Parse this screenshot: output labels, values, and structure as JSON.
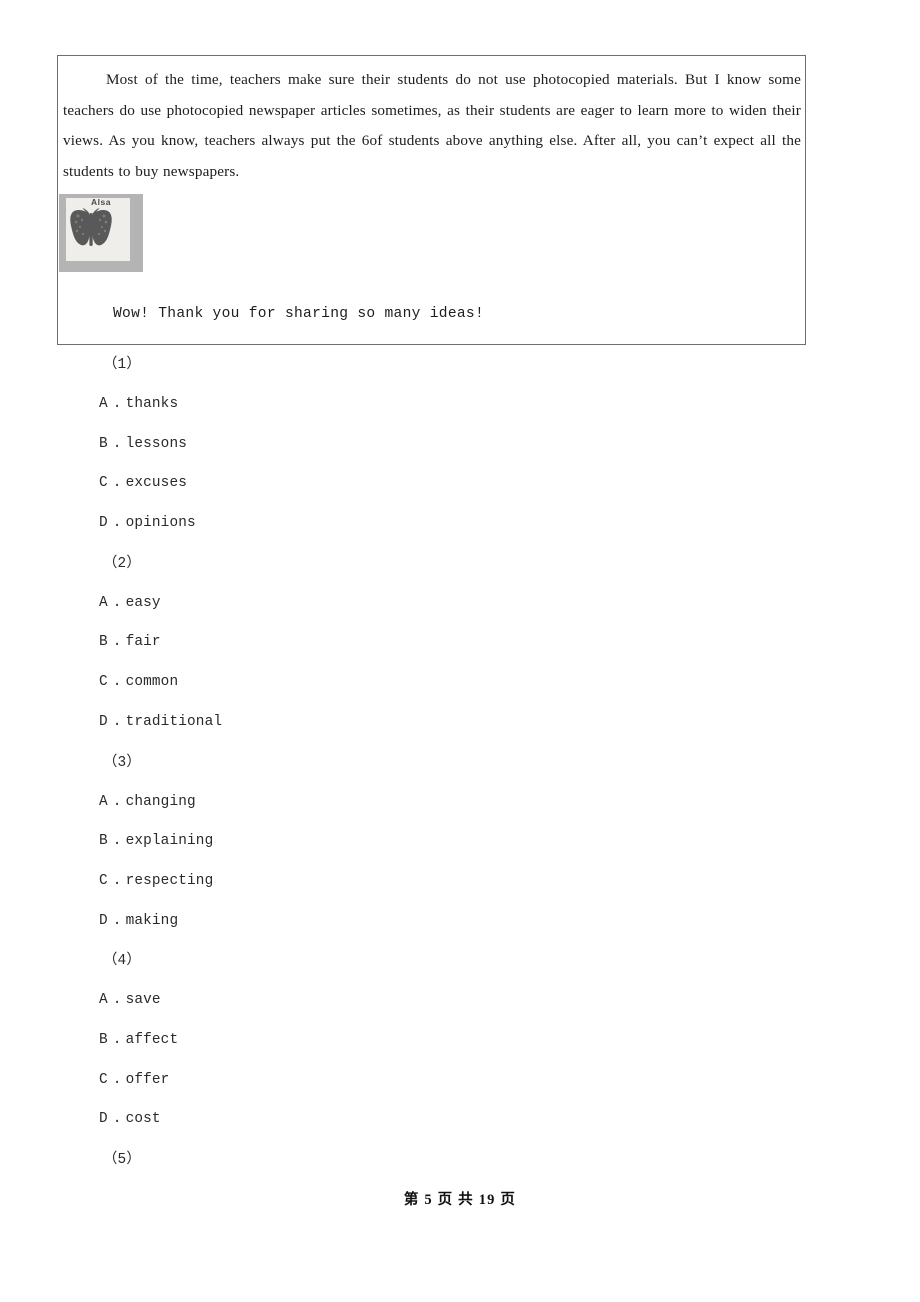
{
  "document": {
    "passage": {
      "paragraph": "Most of the time, teachers make sure their students do not use photocopied materials. But I know some teachers do use photocopied newspaper articles sometimes, as their students are eager to learn more to widen their views. As you know, teachers always put the 6of students above anything else. After all, you can’t expect all the students to buy newspapers.",
      "figure": {
        "label": "Alsa",
        "alt": "butterfly-illustration"
      },
      "closing_line": "Wow! Thank you for sharing so many ideas!"
    },
    "questions": [
      {
        "number": "（1）",
        "options": [
          {
            "letter": "A",
            "separator": ".",
            "text": "thanks"
          },
          {
            "letter": "B",
            "separator": ".",
            "text": "lessons"
          },
          {
            "letter": "C",
            "separator": ".",
            "text": "excuses"
          },
          {
            "letter": "D",
            "separator": ".",
            "text": "opinions"
          }
        ]
      },
      {
        "number": "（2）",
        "options": [
          {
            "letter": "A",
            "separator": ".",
            "text": "easy"
          },
          {
            "letter": "B",
            "separator": ".",
            "text": "fair"
          },
          {
            "letter": "C",
            "separator": ".",
            "text": "common"
          },
          {
            "letter": "D",
            "separator": ".",
            "text": "traditional"
          }
        ]
      },
      {
        "number": "（3）",
        "options": [
          {
            "letter": "A",
            "separator": ".",
            "text": "changing"
          },
          {
            "letter": "B",
            "separator": ".",
            "text": "explaining"
          },
          {
            "letter": "C",
            "separator": ".",
            "text": "respecting"
          },
          {
            "letter": "D",
            "separator": ".",
            "text": "making"
          }
        ]
      },
      {
        "number": "（4）",
        "options": [
          {
            "letter": "A",
            "separator": ".",
            "text": "save"
          },
          {
            "letter": "B",
            "separator": ".",
            "text": "affect"
          },
          {
            "letter": "C",
            "separator": ".",
            "text": "offer"
          },
          {
            "letter": "D",
            "separator": ".",
            "text": "cost"
          }
        ]
      },
      {
        "number": "（5）",
        "options": []
      }
    ],
    "footer": {
      "text": "第 5 页 共 19 页"
    }
  }
}
